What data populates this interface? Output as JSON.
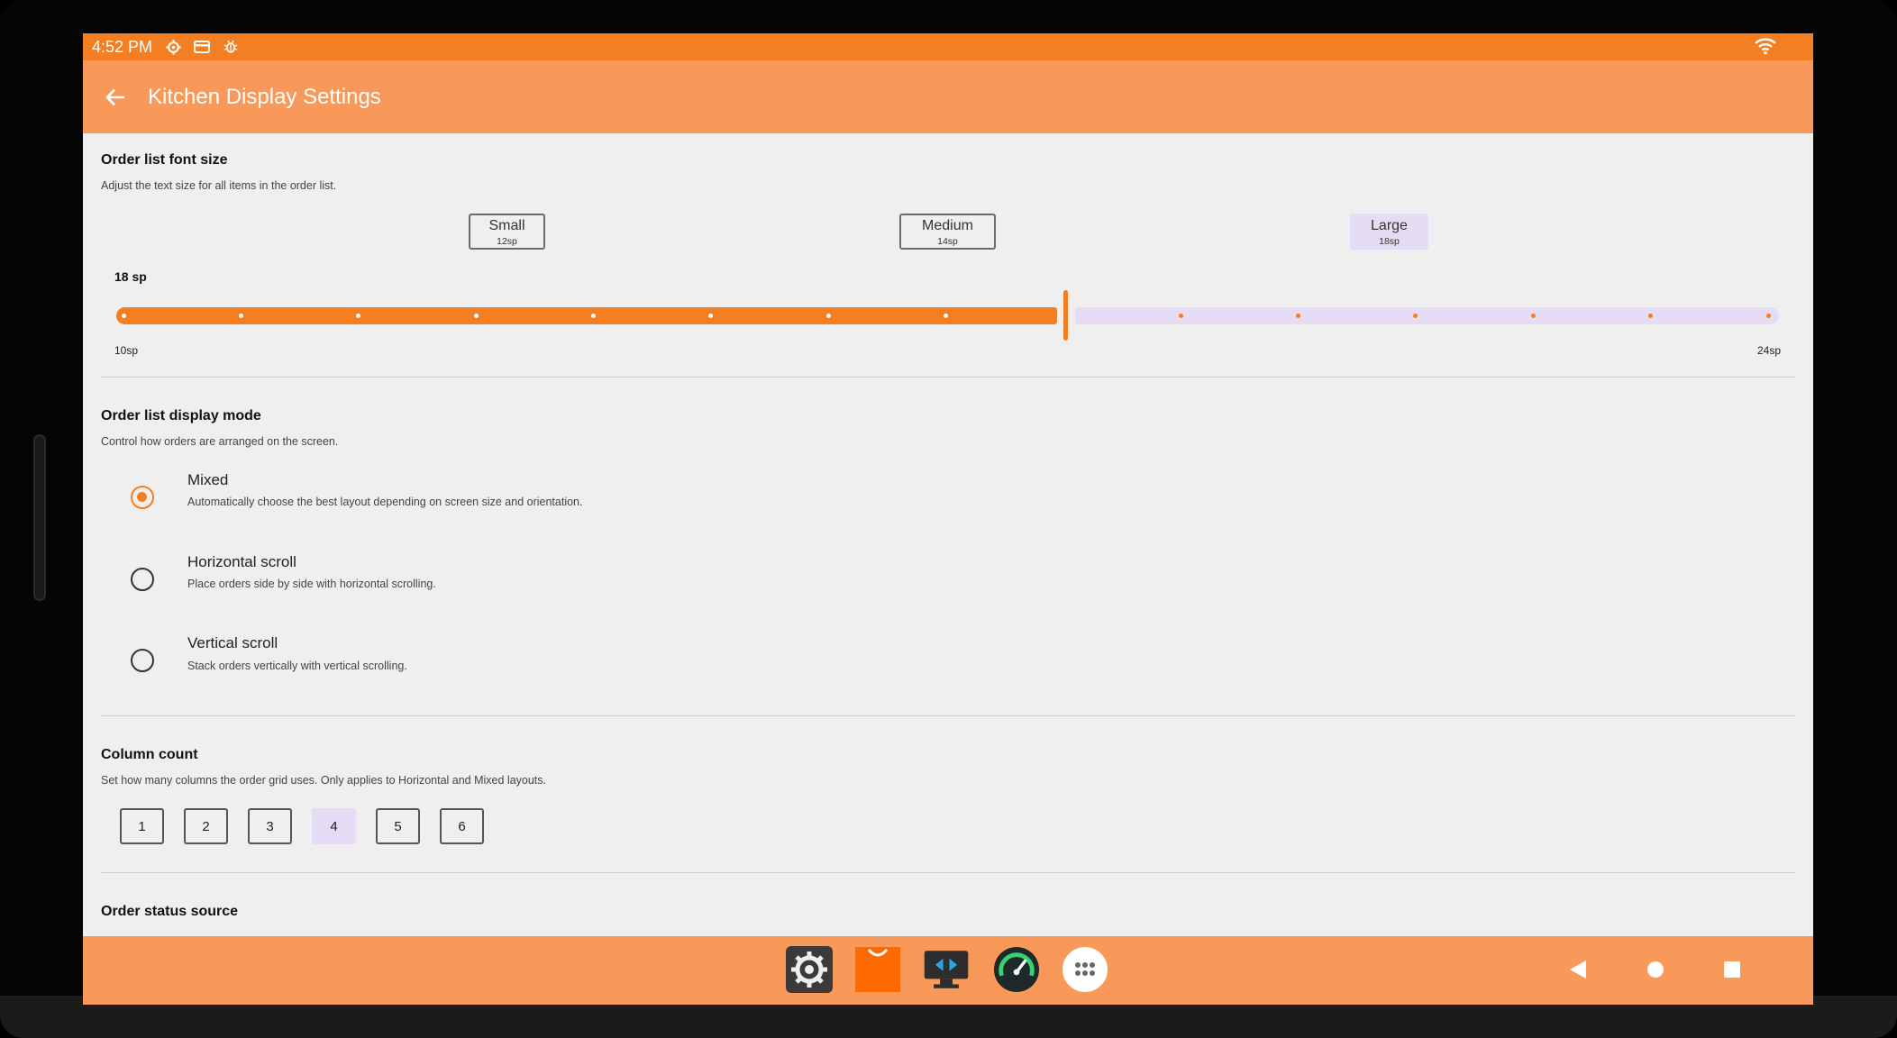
{
  "status_bar": {
    "time": "4:52 PM",
    "icons": [
      "settings-gear-icon",
      "card-icon",
      "bug-icon",
      "wifi-icon"
    ]
  },
  "app_bar": {
    "title": "Kitchen Display Settings",
    "back_icon": "arrow-left-icon"
  },
  "font_size": {
    "title": "Order list font size",
    "description": "Adjust the text size for all items in the order list.",
    "presets": [
      {
        "name": "Small",
        "size": "12sp",
        "selected": false
      },
      {
        "name": "Medium",
        "size": "14sp",
        "selected": false
      },
      {
        "name": "Large",
        "size": "18sp",
        "selected": true
      }
    ],
    "current_value_label": "18 sp",
    "min_label": "10sp",
    "max_label": "24sp",
    "min": 10,
    "max": 24,
    "value": 18
  },
  "display_mode": {
    "title": "Order list display mode",
    "description": "Control how orders are arranged on the screen.",
    "options": [
      {
        "label": "Mixed",
        "description": "Automatically choose the best layout depending on screen size and orientation.",
        "selected": true
      },
      {
        "label": "Horizontal scroll",
        "description": "Place orders side by side with horizontal scrolling.",
        "selected": false
      },
      {
        "label": "Vertical scroll",
        "description": "Stack orders vertically with vertical scrolling.",
        "selected": false
      }
    ]
  },
  "column_count": {
    "title": "Column count",
    "description": "Set how many columns the order grid uses. Only applies to Horizontal and Mixed layouts.",
    "options": [
      "1",
      "2",
      "3",
      "4",
      "5",
      "6"
    ],
    "selected": "4"
  },
  "order_status": {
    "title": "Order status source"
  },
  "dock": {
    "apps": [
      "settings-app-icon",
      "shop-app-icon",
      "remote-desktop-app-icon",
      "speedometer-app-icon",
      "app-drawer-icon"
    ]
  },
  "nav": {
    "keys": [
      "back-triangle-icon",
      "home-circle-icon",
      "recents-square-icon"
    ]
  },
  "colors": {
    "accent": "#f47f22",
    "appbar": "#f8995a",
    "selected_fill": "#e6ddf4"
  }
}
